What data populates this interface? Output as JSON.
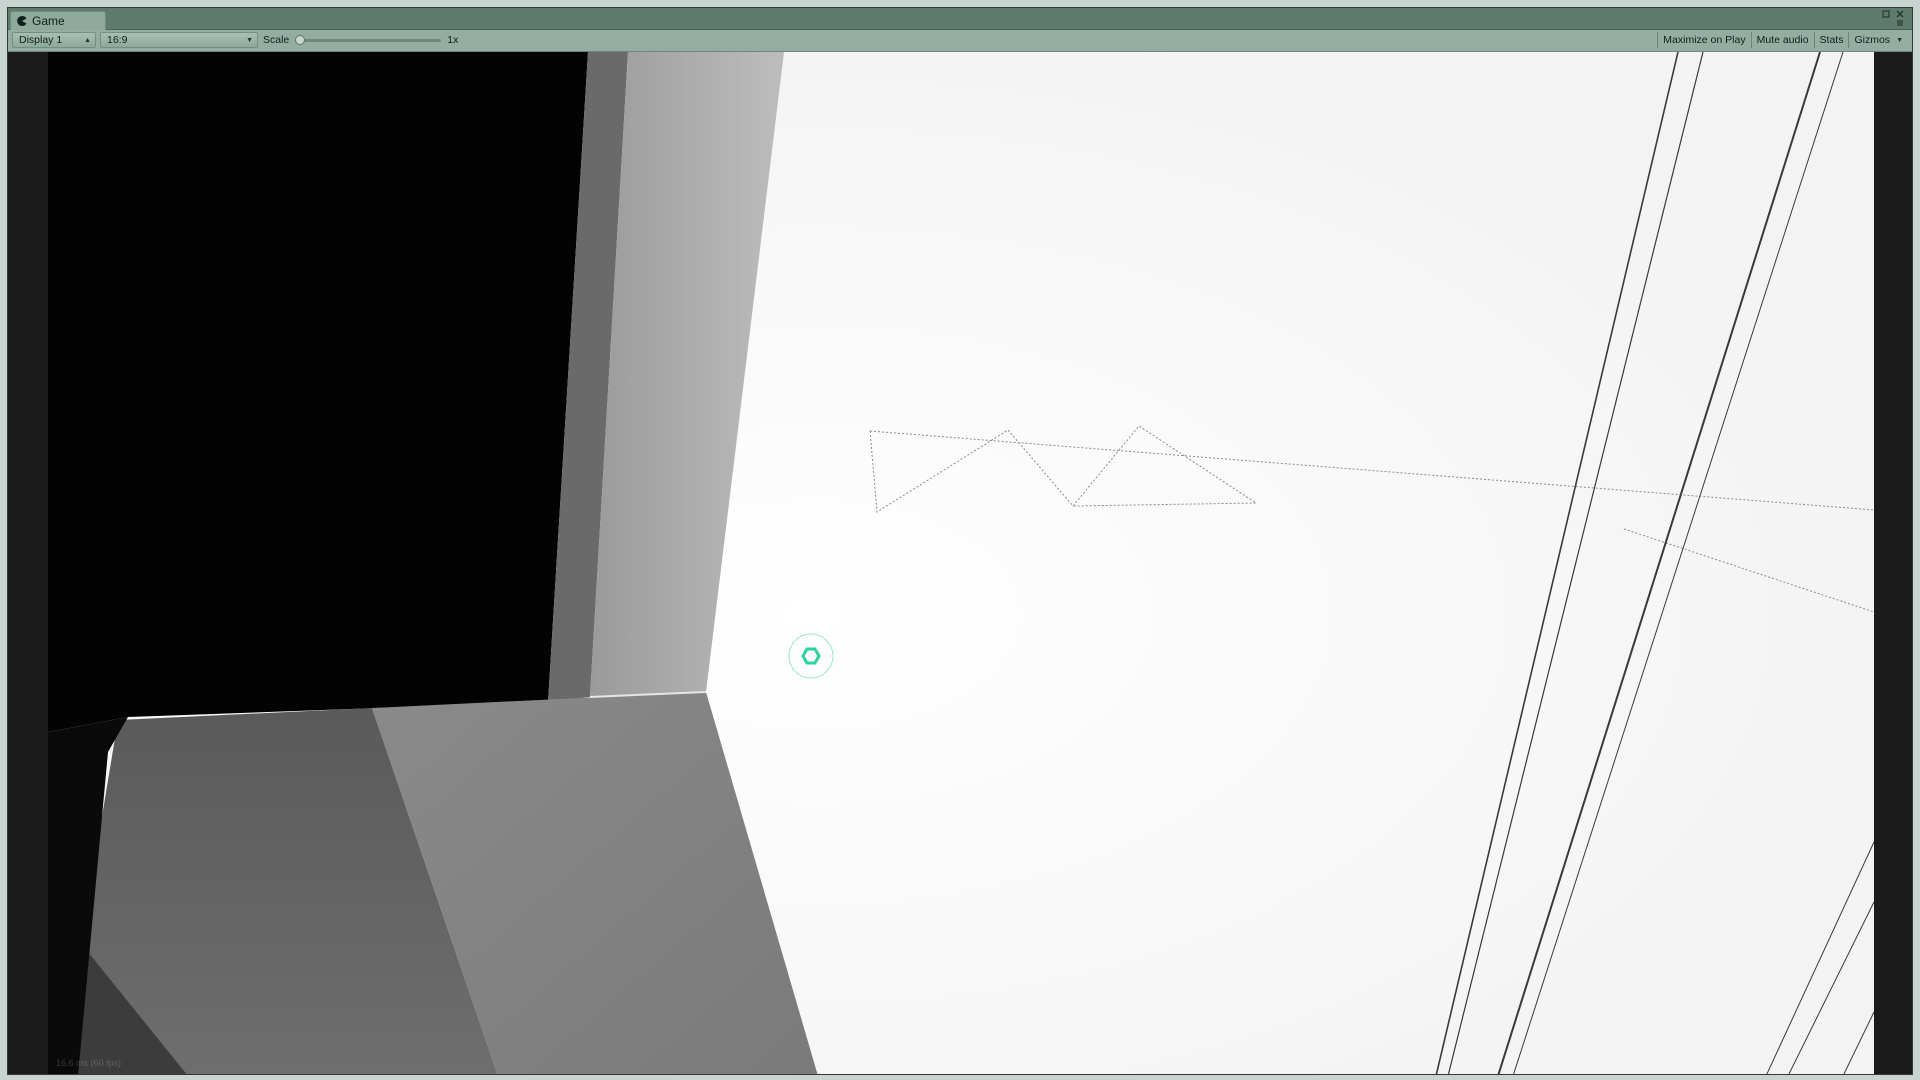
{
  "window": {
    "tab_title": "Game",
    "tab_icon": "pacman-icon",
    "controls": [
      "maximize-icon",
      "close-icon",
      "menu-icon"
    ]
  },
  "toolbar": {
    "display_label": "Display 1",
    "aspect_label": "16:9",
    "scale_label": "Scale",
    "scale_value": "1x",
    "scale_slider_level": 0,
    "maximize_on_play": "Maximize on Play",
    "mute_audio": "Mute audio",
    "stats": "Stats",
    "gizmos": "Gizmos"
  },
  "game": {
    "stats_text": "16.6 ms (60 fps)",
    "reticle_icon": "hexagon-reticle-icon",
    "reticle_color": "#2fd19a"
  },
  "colors": {
    "tab_strip": "#5f7a6f",
    "toolbar": "#94ada2",
    "accent": "#2fd19a"
  }
}
